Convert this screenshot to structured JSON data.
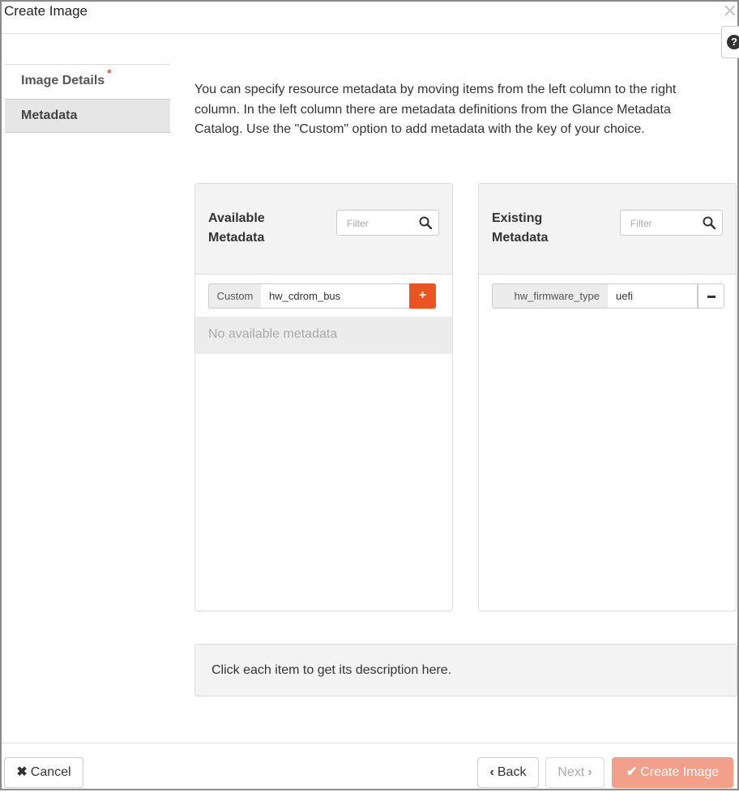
{
  "dialog": {
    "title": "Create Image",
    "close_icon": "close-icon",
    "help_icon": "question-circle-icon"
  },
  "nav": {
    "items": [
      {
        "label": "Image Details",
        "required": "*",
        "active": false
      },
      {
        "label": "Metadata",
        "active": true
      }
    ]
  },
  "intro_text": "You can specify resource metadata by moving items from the left column to the right column. In the left column there are metadata definitions from the Glance Metadata Catalog. Use the \"Custom\" option to add metadata with the key of your choice.",
  "available": {
    "title_line1": "Available",
    "title_line2": "Metadata",
    "filter_placeholder": "Filter",
    "custom_label": "Custom",
    "custom_value": "hw_cdrom_bus",
    "add_glyph": "+",
    "empty_text": "No available metadata"
  },
  "existing": {
    "title_line1": "Existing",
    "title_line2": "Metadata",
    "filter_placeholder": "Filter",
    "items": [
      {
        "key": "hw_firmware_type",
        "value": "uefi"
      }
    ]
  },
  "description_text": "Click each item to get its description here.",
  "footer": {
    "cancel_glyph": "✖",
    "cancel_label": "Cancel",
    "back_glyph": "‹",
    "back_label": "Back",
    "next_label": "Next",
    "next_glyph": "›",
    "create_glyph": "✔",
    "create_label": "Create Image"
  },
  "colors": {
    "accent": "#e95420",
    "create_button": "#f3a08a",
    "required_marker": "#d9534f"
  }
}
